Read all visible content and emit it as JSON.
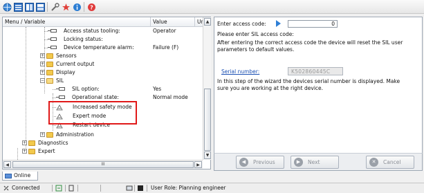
{
  "toolbar": {
    "icons": [
      "globe-icon",
      "view-list-icon",
      "view-grid-icon",
      "view-detail-icon",
      "tools-icon",
      "plugin-icon",
      "info-icon",
      "help-icon"
    ]
  },
  "tree": {
    "headers": {
      "name": "Menu / Variable",
      "value": "Value",
      "unit": "Uni"
    },
    "rows": [
      {
        "label": "Access status tooling:",
        "value": "Operator"
      },
      {
        "label": "Locking status:",
        "value": ""
      },
      {
        "label": "Device temperature alarm:",
        "value": "Failure (F)"
      },
      {
        "label": "Sensors",
        "value": ""
      },
      {
        "label": "Current output",
        "value": ""
      },
      {
        "label": "Display",
        "value": ""
      },
      {
        "label": "SIL",
        "value": ""
      },
      {
        "label": "SIL option:",
        "value": "Yes"
      },
      {
        "label": "Operational state:",
        "value": "Normal mode"
      },
      {
        "label": "Increased safety mode",
        "value": ""
      },
      {
        "label": "Expert mode",
        "value": ""
      },
      {
        "label": "Restart device",
        "value": ""
      },
      {
        "label": "Administration",
        "value": ""
      },
      {
        "label": "Diagnostics",
        "value": ""
      },
      {
        "label": "Expert",
        "value": ""
      }
    ],
    "hscroll_label": "III"
  },
  "tab": {
    "label": "Online"
  },
  "wizard": {
    "access_label": "Enter access code:",
    "access_value": "0",
    "instruction": "Please enter SIL access code:",
    "note_line1": "After entering the correct access code the device will reset the SIL user",
    "note_line2": "parameters to default values.",
    "serial_label": "Serial number:",
    "serial_value": "K502860445C",
    "step_line1": "In this step of the wizard the devices serial number is displayed. Make",
    "step_line2": "sure you are working at the right device.",
    "previous_label": "Previous",
    "next_label": "Next",
    "cancel_label": "Cancel"
  },
  "status": {
    "connection": "Connected",
    "user_role": "User Role: Planning engineer"
  },
  "colors": {
    "highlight": "#e01818",
    "link": "#1a4fb3",
    "accent": "#2f7fd6"
  }
}
